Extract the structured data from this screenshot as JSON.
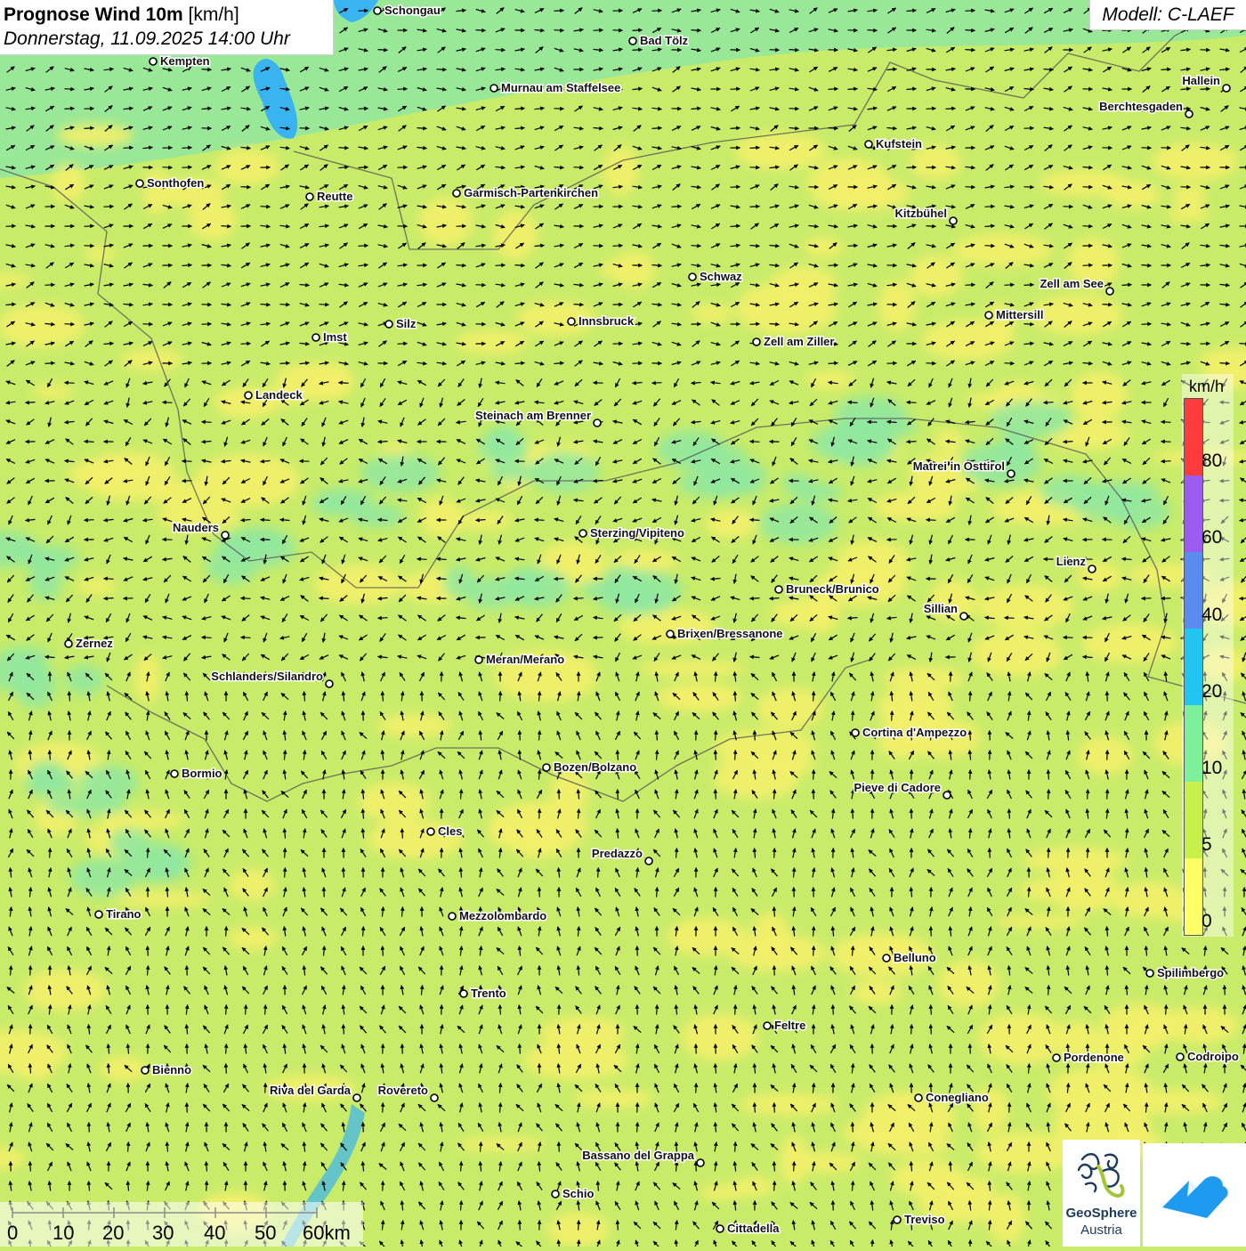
{
  "title": {
    "bold": "Prognose Wind 10m",
    "unit": " [km/h]",
    "date": "Donnerstag, 11.09.2025 14:00 Uhr"
  },
  "model": "Modell: C-LAEF",
  "legend": {
    "unit": "km/h",
    "ticks": [
      "80",
      "60",
      "40",
      "20",
      "10",
      "5",
      "0"
    ],
    "colors": [
      "#ff3b3b",
      "#9c5cf2",
      "#5a8cf0",
      "#22c4f2",
      "#7df09a",
      "#c8f04a",
      "#ffff66"
    ]
  },
  "scalebar": {
    "labels": [
      "0",
      "10",
      "20",
      "30",
      "40",
      "50",
      "60km"
    ]
  },
  "logos": {
    "geosphere_line1": "GeoSphere",
    "geosphere_line2": "Austria"
  },
  "colors": {
    "background": "#c8ec6a",
    "calm_yellow": "#f3f06a",
    "breezy_green": "#90e8a0",
    "water": "#3ab4f0",
    "arrow": "#000000"
  },
  "cities": [
    "Schongau",
    "Bad Tölz",
    "Kempten",
    "Hallein",
    "Murnau am Staffelsee",
    "Berchtesgaden",
    "Kufstein",
    "Sonthofen",
    "Reutte",
    "Garmisch-Partenkirchen",
    "Kitzbühel",
    "Schwaz",
    "Zell am See",
    "Mittersill",
    "Innsbruck",
    "Silz",
    "Imst",
    "Zell am Ziller",
    "Landeck",
    "Steinach am Brenner",
    "Matrei in Osttirol",
    "Nauders",
    "Sterzing/Vipiteno",
    "Lienz",
    "Bruneck/Brunico",
    "Sillian",
    "Brixen/Bressanone",
    "Zernez",
    "Meran/Merano",
    "Schlanders/Silandro",
    "Cortina d'Ampezzo",
    "Bozen/Bolzano",
    "Bormio",
    "Pieve di Cadore",
    "Cles",
    "Predazzo",
    "Tirano",
    "Mezzolombardo",
    "Belluno",
    "Spilimbergo",
    "Trento",
    "Feltre",
    "Pordenone",
    "Codroipo",
    "Bienno",
    "Riva del Garda",
    "Rovereto",
    "Conegliano",
    "Bassano del Grappa",
    "Schio",
    "Treviso",
    "Cittadella"
  ]
}
